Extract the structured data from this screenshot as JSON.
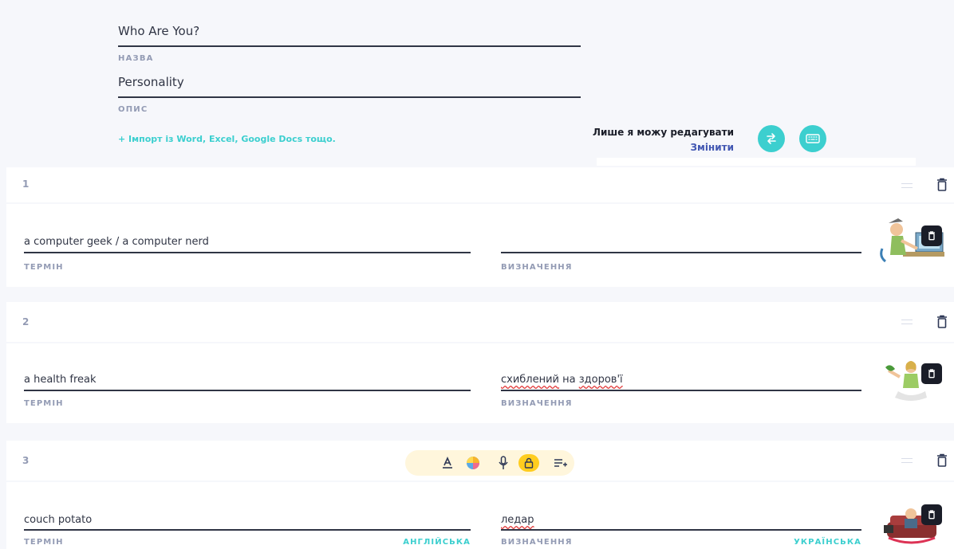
{
  "set": {
    "title_value": "Who Are You?",
    "title_label": "НАЗВА",
    "description_value": "Personality",
    "description_label": "ОПИС",
    "import_link": "+ Імпорт із Word, Excel, Google Docs тощо."
  },
  "permissions": {
    "text": "Лише я можу редагувати",
    "change_label": "Змінити"
  },
  "icons": {
    "swap": "swap-arrows-icon",
    "keyboard": "keyboard-icon",
    "trash": "trash-icon",
    "drag": "drag-handle-icon"
  },
  "cards": [
    {
      "number": "1",
      "term": "a computer geek / a computer nerd",
      "definition": "",
      "term_label": "ТЕРМІН",
      "definition_label": "ВИЗНАЧЕННЯ",
      "term_lang": "",
      "definition_lang": ""
    },
    {
      "number": "2",
      "term": "a health freak",
      "definition_parts": [
        "схиблений",
        " на ",
        "здоров'ї"
      ],
      "term_label": "ТЕРМІН",
      "definition_label": "ВИЗНАЧЕННЯ",
      "term_lang": "",
      "definition_lang": ""
    },
    {
      "number": "3",
      "term": "couch potato",
      "definition": "ледар",
      "term_label": "ТЕРМІН",
      "definition_label": "ВИЗНАЧЕННЯ",
      "term_lang": "АНГЛІЙСЬКА",
      "definition_lang": "УКРАЇНСЬКА"
    }
  ],
  "toolbar": {
    "items": [
      "text-format-icon",
      "color-picker-icon",
      "microphone-icon",
      "lock-icon",
      "add-list-icon"
    ]
  },
  "colors": {
    "accent": "#3ccfcf",
    "link": "#4257b2",
    "toolbar_bg": "#fff6dc",
    "lock_bg": "#ffcd1f"
  }
}
